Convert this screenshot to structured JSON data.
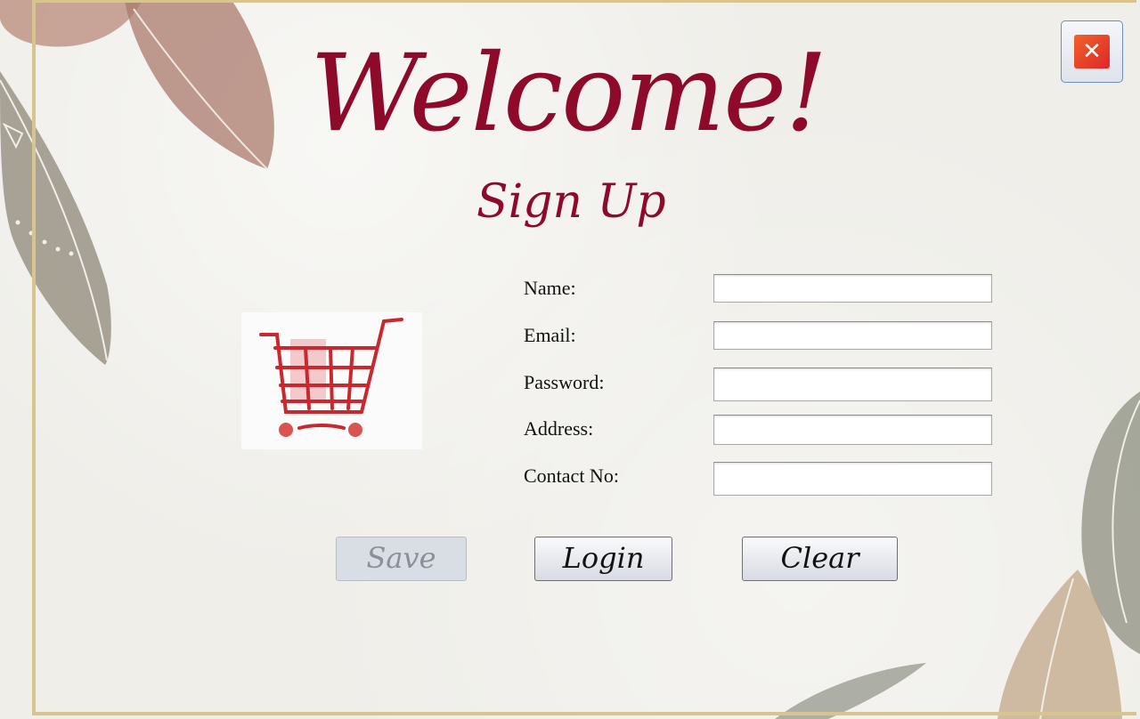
{
  "header": {
    "title": "Welcome!",
    "subtitle": "Sign Up"
  },
  "window": {
    "close_label": "✕"
  },
  "logo": {
    "icon": "shopping-cart-icon",
    "color": "#c8282e"
  },
  "form": {
    "fields": [
      {
        "label": "Name:",
        "value": ""
      },
      {
        "label": "Email:",
        "value": ""
      },
      {
        "label": "Password:",
        "value": ""
      },
      {
        "label": "Address:",
        "value": ""
      },
      {
        "label": "Contact No:",
        "value": ""
      }
    ]
  },
  "buttons": {
    "save": "Save",
    "login": "Login",
    "clear": "Clear"
  },
  "colors": {
    "title": "#8e0a2b",
    "frame": "#d8c48f",
    "close": "#e0252a"
  }
}
